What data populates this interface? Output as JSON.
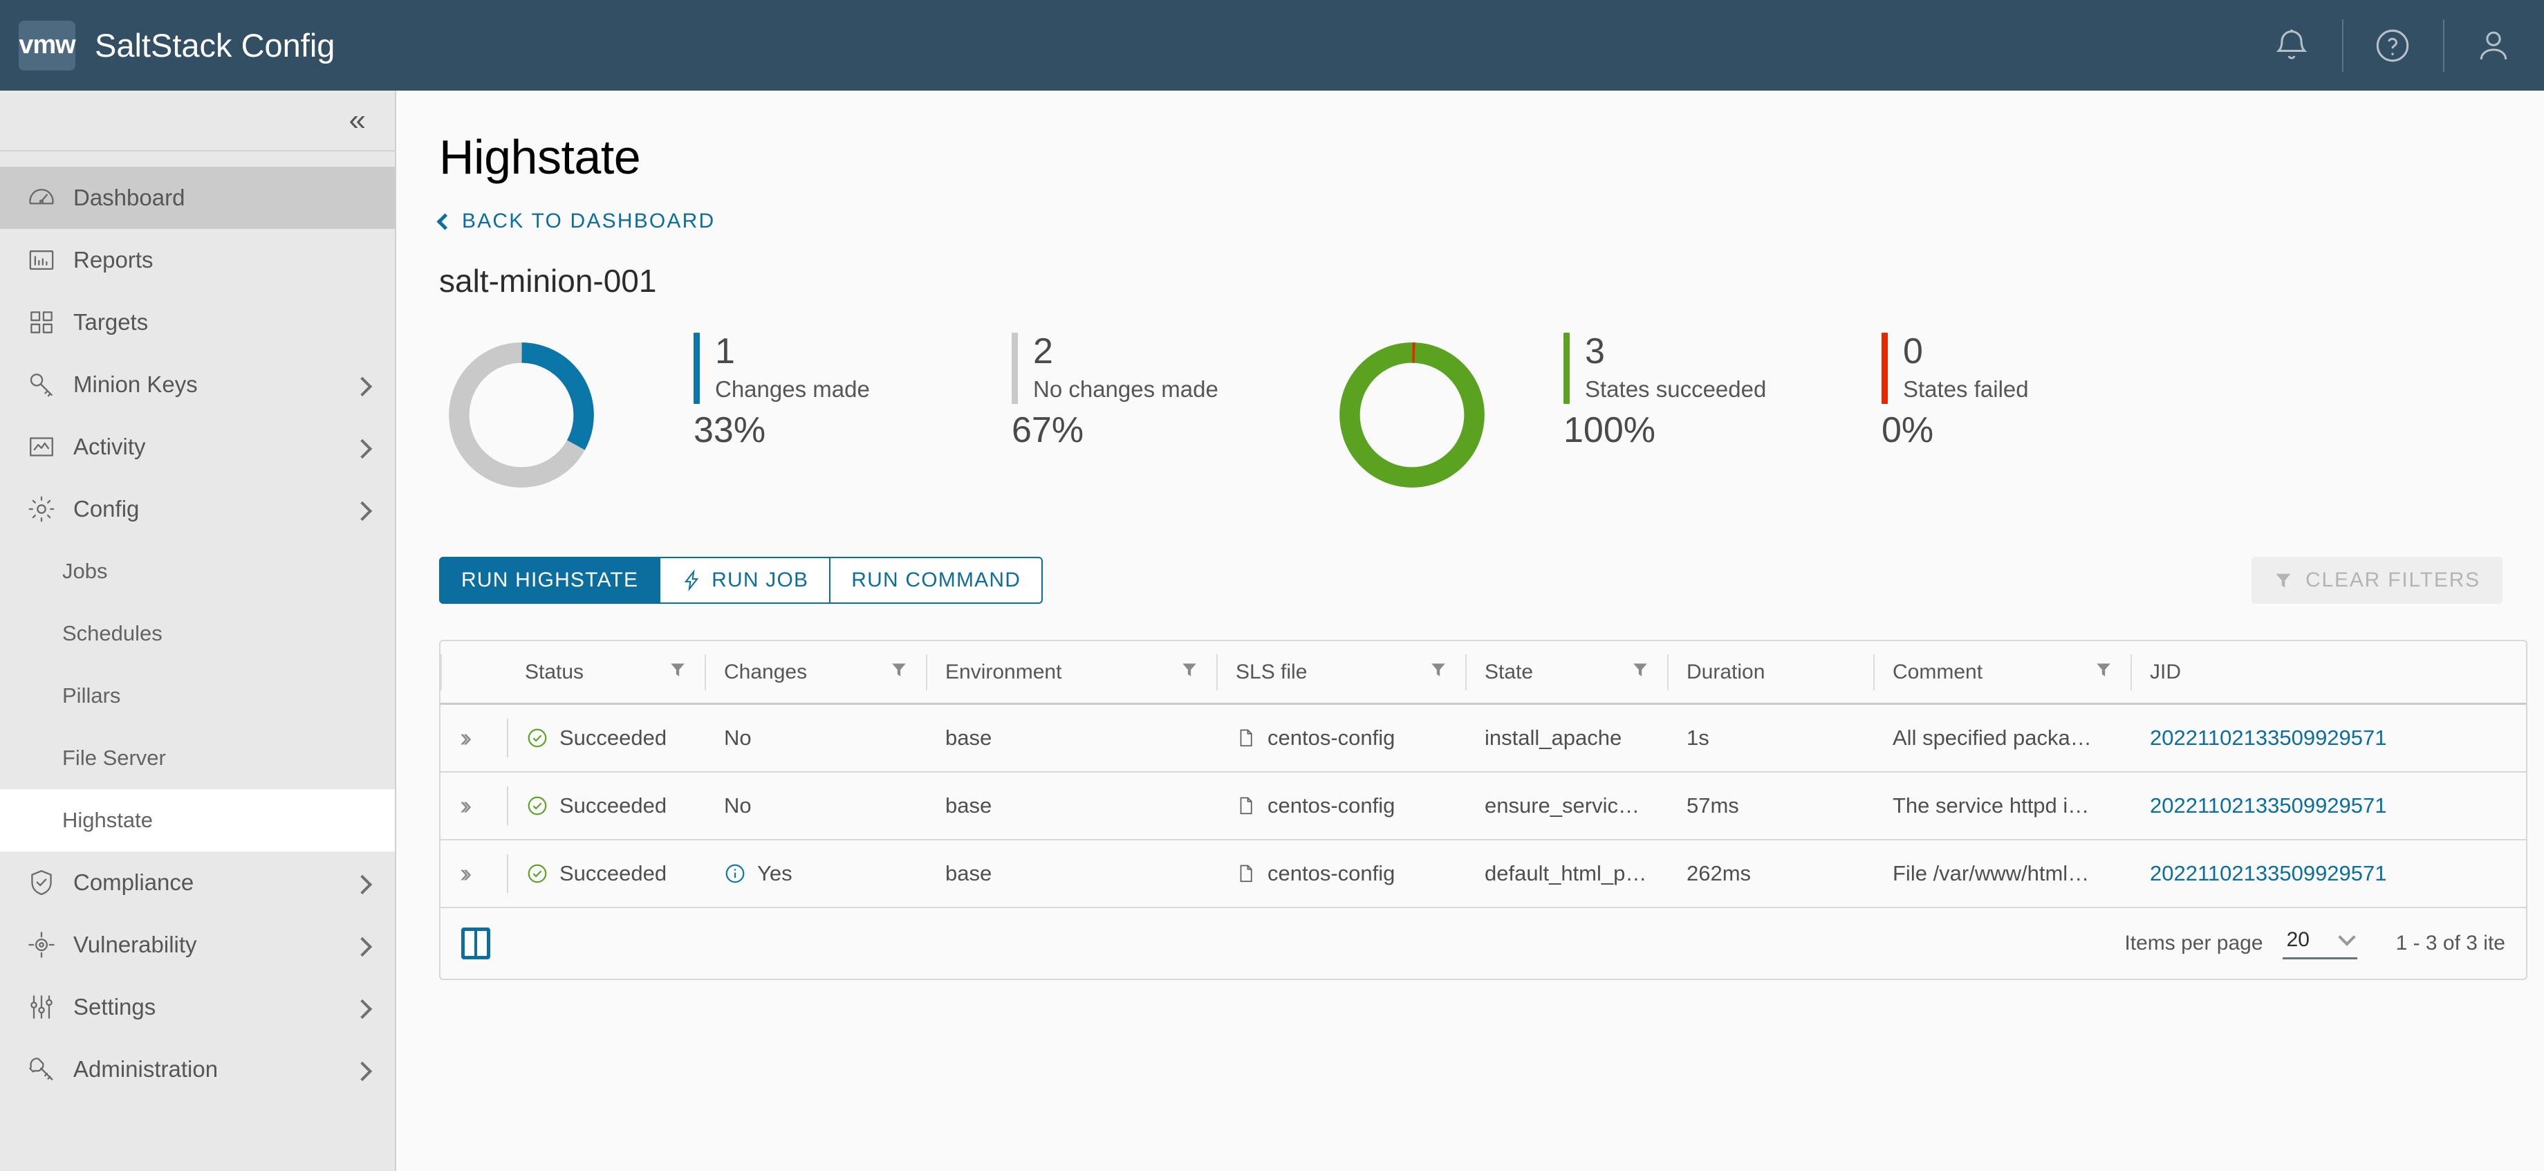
{
  "header": {
    "logo_text": "vmw",
    "title": "SaltStack Config",
    "icons": [
      {
        "name": "bell-icon"
      },
      {
        "name": "help-icon"
      },
      {
        "name": "user-icon"
      }
    ]
  },
  "sidebar": {
    "collapse_label": "«",
    "items": [
      {
        "label": "Dashboard",
        "icon": "dashboard-icon",
        "active": true,
        "expandable": false,
        "sub": false
      },
      {
        "label": "Reports",
        "icon": "reports-icon",
        "active": false,
        "expandable": false,
        "sub": false
      },
      {
        "label": "Targets",
        "icon": "targets-icon",
        "active": false,
        "expandable": false,
        "sub": false
      },
      {
        "label": "Minion Keys",
        "icon": "key-icon",
        "active": false,
        "expandable": true,
        "sub": false
      },
      {
        "label": "Activity",
        "icon": "activity-icon",
        "active": false,
        "expandable": true,
        "sub": false
      },
      {
        "label": "Config",
        "icon": "gear-icon",
        "active": false,
        "expandable": true,
        "sub": false
      },
      {
        "label": "Jobs",
        "icon": "",
        "active": false,
        "expandable": false,
        "sub": true
      },
      {
        "label": "Schedules",
        "icon": "",
        "active": false,
        "expandable": false,
        "sub": true
      },
      {
        "label": "Pillars",
        "icon": "",
        "active": false,
        "expandable": false,
        "sub": true
      },
      {
        "label": "File Server",
        "icon": "",
        "active": false,
        "expandable": false,
        "sub": true
      },
      {
        "label": "Highstate",
        "icon": "",
        "active": true,
        "expandable": false,
        "sub": true
      },
      {
        "label": "Compliance",
        "icon": "shield-icon",
        "active": false,
        "expandable": true,
        "sub": false
      },
      {
        "label": "Vulnerability",
        "icon": "target-icon",
        "active": false,
        "expandable": true,
        "sub": false
      },
      {
        "label": "Settings",
        "icon": "sliders-icon",
        "active": false,
        "expandable": true,
        "sub": false
      },
      {
        "label": "Administration",
        "icon": "wrench-icon",
        "active": false,
        "expandable": true,
        "sub": false
      }
    ]
  },
  "main": {
    "page_title": "Highstate",
    "back_link": "BACK TO DASHBOARD",
    "minion_name": "salt-minion-001"
  },
  "chart_data": [
    {
      "type": "pie",
      "title": "Changes",
      "categories": [
        "Changes made",
        "No changes made"
      ],
      "values": [
        1,
        2
      ],
      "percents": [
        33,
        67
      ],
      "colors": [
        "#0b76a8",
        "#c9c9c9"
      ],
      "legend": "right"
    },
    {
      "type": "pie",
      "title": "States",
      "categories": [
        "States succeeded",
        "States failed"
      ],
      "values": [
        3,
        0
      ],
      "percents": [
        100,
        0
      ],
      "colors": [
        "#5aa220",
        "#e62700"
      ],
      "legend": "right"
    }
  ],
  "stats": [
    {
      "num": "1",
      "label": "Changes made",
      "pct": "33%",
      "color": "#0b76a8"
    },
    {
      "num": "2",
      "label": "No changes made",
      "pct": "67%",
      "color": "#c9c9c9"
    },
    {
      "num": "3",
      "label": "States succeeded",
      "pct": "100%",
      "color": "#5aa220"
    },
    {
      "num": "0",
      "label": "States failed",
      "pct": "0%",
      "color": "#e62700"
    }
  ],
  "actions": {
    "run_highstate": "RUN HIGHSTATE",
    "run_job": "RUN JOB",
    "run_command": "RUN COMMAND",
    "clear_filters": "CLEAR FILTERS"
  },
  "table": {
    "columns": [
      {
        "label": "Status",
        "filter": true
      },
      {
        "label": "Changes",
        "filter": true
      },
      {
        "label": "Environment",
        "filter": true
      },
      {
        "label": "SLS file",
        "filter": true
      },
      {
        "label": "State",
        "filter": true
      },
      {
        "label": "Duration",
        "filter": false
      },
      {
        "label": "Comment",
        "filter": true
      },
      {
        "label": "JID",
        "filter": false
      }
    ],
    "rows": [
      {
        "status": "Succeeded",
        "changes": "No",
        "changes_icon": false,
        "environment": "base",
        "sls_file": "centos-config",
        "state": "install_apache",
        "duration": "1s",
        "comment": "All specified packa…",
        "jid": "20221102133509929571"
      },
      {
        "status": "Succeeded",
        "changes": "No",
        "changes_icon": false,
        "environment": "base",
        "sls_file": "centos-config",
        "state": "ensure_service…",
        "duration": "57ms",
        "comment": "The service httpd i…",
        "jid": "20221102133509929571"
      },
      {
        "status": "Succeeded",
        "changes": "Yes",
        "changes_icon": true,
        "environment": "base",
        "sls_file": "centos-config",
        "state": "default_html_p…",
        "duration": "262ms",
        "comment": "File /var/www/html…",
        "jid": "20221102133509929571"
      }
    ],
    "footer": {
      "items_per_page_label": "Items per page",
      "items_per_page_value": "20",
      "range": "1 - 3 of 3 ite"
    }
  }
}
